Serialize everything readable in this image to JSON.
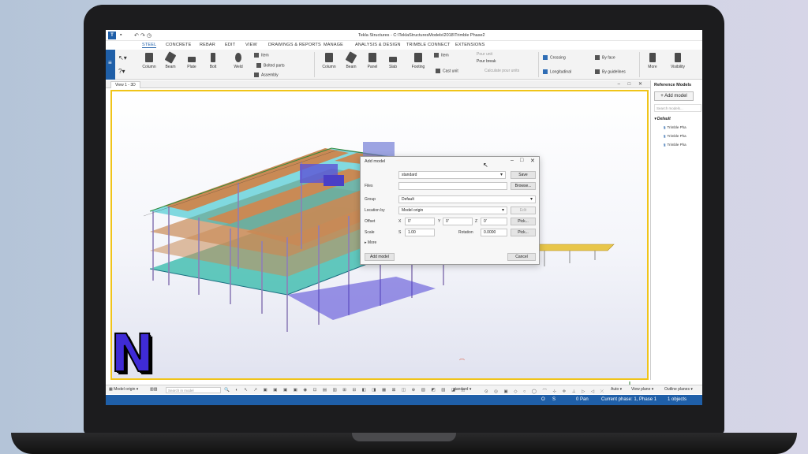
{
  "window": {
    "title": "Tekla Structures - C:\\TeklaStructuresModels\\2018\\Trimble Phase2"
  },
  "ribbon_tabs": [
    {
      "label": "STEEL",
      "active": true
    },
    {
      "label": "CONCRETE"
    },
    {
      "label": "REBAR"
    },
    {
      "label": "EDIT"
    },
    {
      "label": "VIEW"
    },
    {
      "label": "DRAWINGS & REPORTS"
    },
    {
      "label": "MANAGE"
    },
    {
      "label": "ANALYSIS & DESIGN"
    },
    {
      "label": "TRIMBLE CONNECT"
    },
    {
      "label": "EXTENSIONS"
    }
  ],
  "ribbon": {
    "steel": {
      "column": "Column",
      "beam": "Beam",
      "plate": "Plate",
      "bolt": "Bolt",
      "weld": "Weld",
      "item": "Item",
      "bolted_parts": "Bolted parts",
      "assembly": "Assembly"
    },
    "concrete": {
      "column": "Column",
      "beam": "Beam",
      "panel": "Panel",
      "slab": "Slab",
      "footing": "Footing",
      "item": "Item",
      "cast_unit": "Cast unit",
      "pour_unit": "Pour unit",
      "pour_break": "Pour break",
      "calculate_pour_units": "Calculate pour units"
    },
    "rebar": {
      "crossing": "Crossing",
      "longitudinal": "Longitudinal",
      "by_face": "By face",
      "by_guidelines": "By guidelines"
    },
    "more": "More",
    "visibility": "Visibility"
  },
  "view": {
    "tab_label": "View 1 - 3D"
  },
  "reference_panel": {
    "title": "Reference Models",
    "add_button": "+ Add model",
    "search_placeholder": "Search models...",
    "group": "Default",
    "items": [
      "Trimble Pha",
      "Trimble Pha",
      "Trimble Pha"
    ]
  },
  "dialog": {
    "title": "Add model",
    "preset_value": "standard",
    "save": "Save",
    "files_label": "Files",
    "files_value": "",
    "browse": "Browse...",
    "group_label": "Group",
    "group_value": "Default",
    "location_label": "Location by",
    "location_value": "Model origin",
    "edit": "Edit",
    "offset_label": "Offset",
    "x_label": "X",
    "x_value": "0'",
    "y_label": "Y",
    "y_value": "0'",
    "z_label": "Z",
    "z_value": "0'",
    "pick": "Pick...",
    "scale_label": "Scale",
    "scale_s": "S",
    "scale_value": "1.00",
    "rotation_label": "Rotation",
    "rotation_value": "0.0000",
    "more": "▸ More",
    "add_model": "Add model",
    "cancel": "Cancel"
  },
  "bottom_bar": {
    "location": "Model origin",
    "search_placeholder": "Search in model",
    "selection_filter": "standard",
    "auto": "Auto",
    "view_plane": "View plane",
    "outline_planes": "Outline planes"
  },
  "status_bar": {
    "o": "O",
    "s": "S",
    "pan": "0 Pan",
    "phase": "Current phase: 1, Phase 1",
    "objects": "1 objects"
  },
  "overlay_logo": "N",
  "colors": {
    "accent": "#1f5fa8",
    "viewport_border": "#f0c419",
    "slab": "#c98a55",
    "beam": "#1fc0c8",
    "column": "#8e7eb8",
    "logo": "#3f2bd6"
  }
}
